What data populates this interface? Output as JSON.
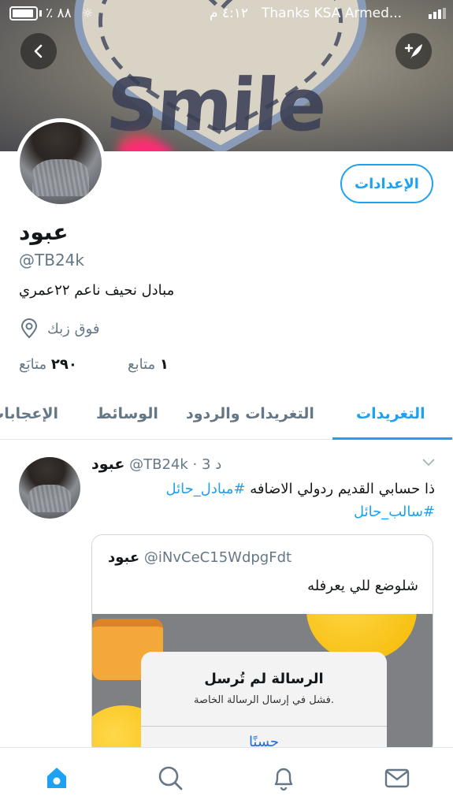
{
  "status_bar": {
    "battery_percent": "٪ ٨٨",
    "loading": "☼",
    "time": "٤:١٢ م",
    "carrier": "Thanks KSA Armed..."
  },
  "header": {
    "banner_text": "Smile"
  },
  "profile": {
    "settings_label": "الإعدادات",
    "name": "عبود",
    "handle": "@TB24k",
    "bio": "مبادل نحيف ناعم ٢٢عمري",
    "location": "فوق زبك",
    "following_count": "١",
    "following_label": "متابع",
    "followers_count": "٢٩٠",
    "followers_label": "متابَع"
  },
  "tabs": [
    {
      "label": "التغريدات",
      "active": true
    },
    {
      "label": "التغريدات والردود",
      "active": false
    },
    {
      "label": "الوسائط",
      "active": false
    },
    {
      "label": "الإعجابات",
      "active": false
    }
  ],
  "tweet": {
    "author": "عبود",
    "handle": "@TB24k",
    "time": "3 د",
    "text_part1": "ذا حسابي القديم ردولي الاضافه ",
    "hashtag1": "#مبادل_حائل",
    "hashtag2": "#سالب_حائل",
    "quote": {
      "author": "عبود",
      "handle": "@iNvCeC15WdpgFdt",
      "text": "شلوضع للي يعرفله",
      "dialog_title": "الرسالة لم تُرسل",
      "dialog_message": "فشل في إرسال الرسالة الخاصة.",
      "dialog_button": "حسنًا"
    }
  },
  "colors": {
    "accent": "#1da1f2",
    "secondary_text": "#657786"
  }
}
